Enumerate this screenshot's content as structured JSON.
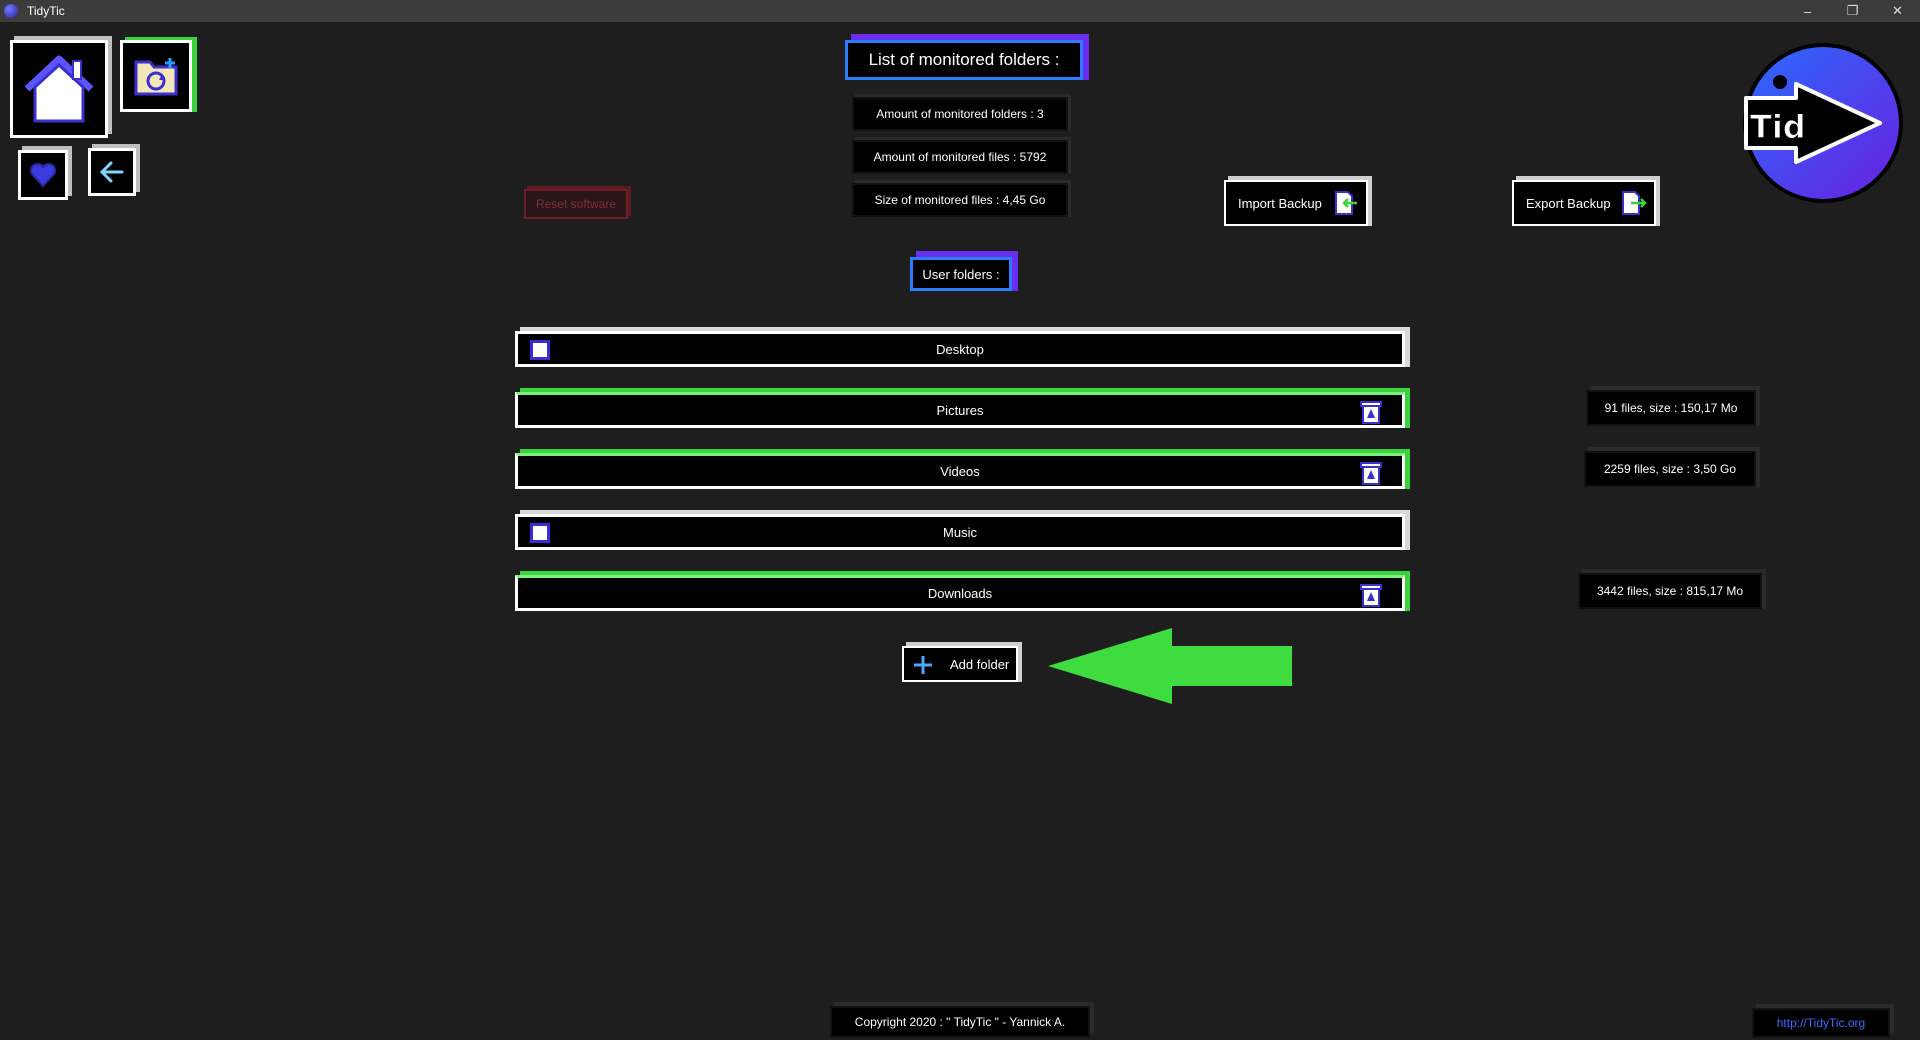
{
  "window": {
    "title": "TidyTic",
    "controls": {
      "minimize": "–",
      "restore": "❐",
      "close": "✕"
    }
  },
  "nav": {
    "home_icon": "home-icon",
    "folder_icon": "folder-refresh-icon",
    "heart_icon": "heart-icon",
    "back_icon": "arrow-left-icon"
  },
  "header": {
    "title": "List of monitored folders :"
  },
  "stats": {
    "folders": "Amount of monitored folders : 3",
    "files": "Amount of monitored files : 5792",
    "size": "Size of monitored files : 4,45 Go"
  },
  "actions": {
    "reset": "Reset software",
    "import": "Import Backup",
    "export": "Export Backup",
    "add_folder": "Add folder"
  },
  "logo_text": "Tid",
  "user_folders": {
    "title": "User folders :",
    "rows": [
      {
        "name": "Desktop",
        "monitored": false,
        "info": ""
      },
      {
        "name": "Pictures",
        "monitored": true,
        "info": "91 files, size : 150,17 Mo"
      },
      {
        "name": "Videos",
        "monitored": true,
        "info": "2259 files, size : 3,50 Go"
      },
      {
        "name": "Music",
        "monitored": false,
        "info": ""
      },
      {
        "name": "Downloads",
        "monitored": true,
        "info": "3442 files, size : 815,17 Mo"
      }
    ]
  },
  "footer": {
    "copyright": "Copyright 2020 : \" TidyTic \" - Yannick A.",
    "website": "http://TidyTic.org"
  },
  "colors": {
    "background": "#1e1e1e",
    "accent_blue": "#2d7bff",
    "accent_purple": "#6a2ef0",
    "monitored_green": "#3bd33b",
    "reset_red": "#6b1f24",
    "link_blue": "#3a6bff"
  }
}
